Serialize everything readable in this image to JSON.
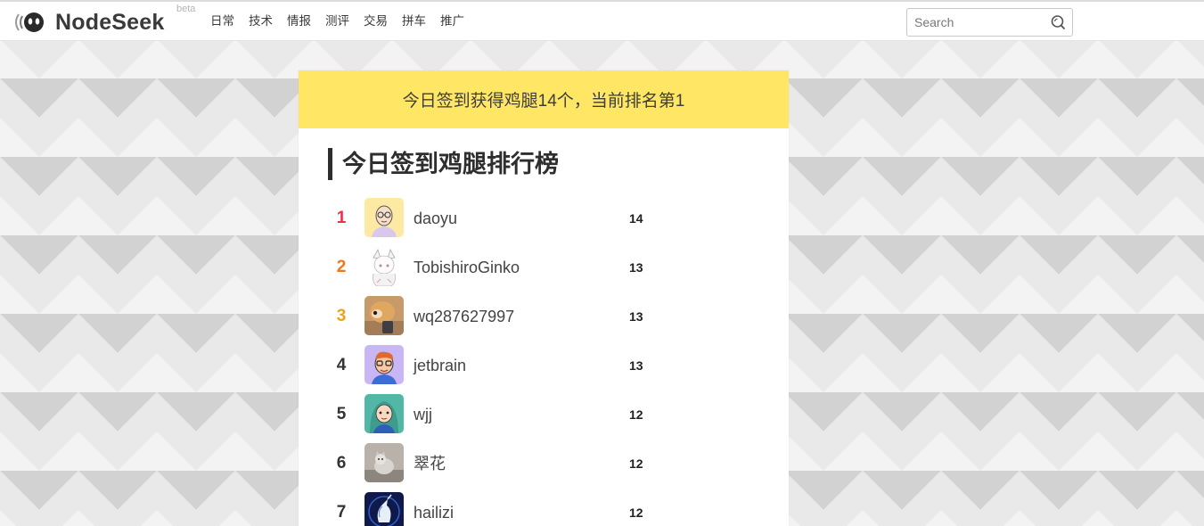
{
  "header": {
    "brand": "NodeSeek",
    "beta": "beta",
    "nav": [
      "日常",
      "技术",
      "情报",
      "测评",
      "交易",
      "拼车",
      "推广"
    ],
    "search": {
      "placeholder": "Search",
      "value": ""
    }
  },
  "banner": {
    "text": "今日签到获得鸡腿14个，当前排名第1"
  },
  "leaderboard": {
    "title": "今日签到鸡腿排行榜",
    "rows": [
      {
        "rank": "1",
        "name": "daoyu",
        "score": "14",
        "rank_color": "#ef2f48"
      },
      {
        "rank": "2",
        "name": "TobishiroGinko",
        "score": "13",
        "rank_color": "#f2761a"
      },
      {
        "rank": "3",
        "name": "wq287627997",
        "score": "13",
        "rank_color": "#f0a21c"
      },
      {
        "rank": "4",
        "name": "jetbrain",
        "score": "13",
        "rank_color": "#333333"
      },
      {
        "rank": "5",
        "name": "wjj",
        "score": "12",
        "rank_color": "#333333"
      },
      {
        "rank": "6",
        "name": "翠花",
        "score": "12",
        "rank_color": "#333333"
      },
      {
        "rank": "7",
        "name": "hailizi",
        "score": "12",
        "rank_color": "#333333"
      }
    ]
  }
}
